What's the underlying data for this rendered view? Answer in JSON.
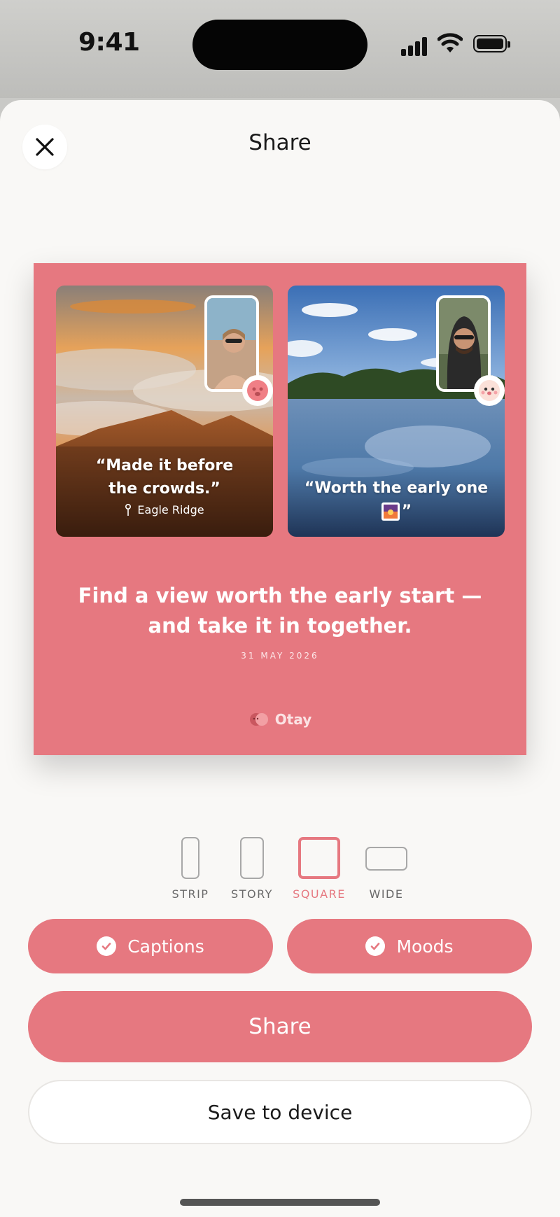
{
  "status_bar": {
    "time": "9:41"
  },
  "header": {
    "title": "Share"
  },
  "preview": {
    "photos": [
      {
        "caption": "“Made it before the crowds.”",
        "caption_line1": "“Made it before",
        "caption_line2": "the crowds.”",
        "location": "Eagle Ridge"
      },
      {
        "caption_line1": "“Worth the early one",
        "caption_line2_suffix": "”"
      }
    ],
    "headline": "Find a view worth the early start — and take it in together.",
    "date": "31 MAY 2026",
    "brand": "Otay"
  },
  "formats": {
    "selected": "SQUARE",
    "items": [
      {
        "label": "STRIP"
      },
      {
        "label": "STORY"
      },
      {
        "label": "SQUARE"
      },
      {
        "label": "WIDE"
      }
    ]
  },
  "toggles": {
    "captions": "Captions",
    "moods": "Moods"
  },
  "actions": {
    "share": "Share",
    "save": "Save to device"
  },
  "colors": {
    "accent": "#e67880",
    "sheet": "#f9f8f6"
  }
}
